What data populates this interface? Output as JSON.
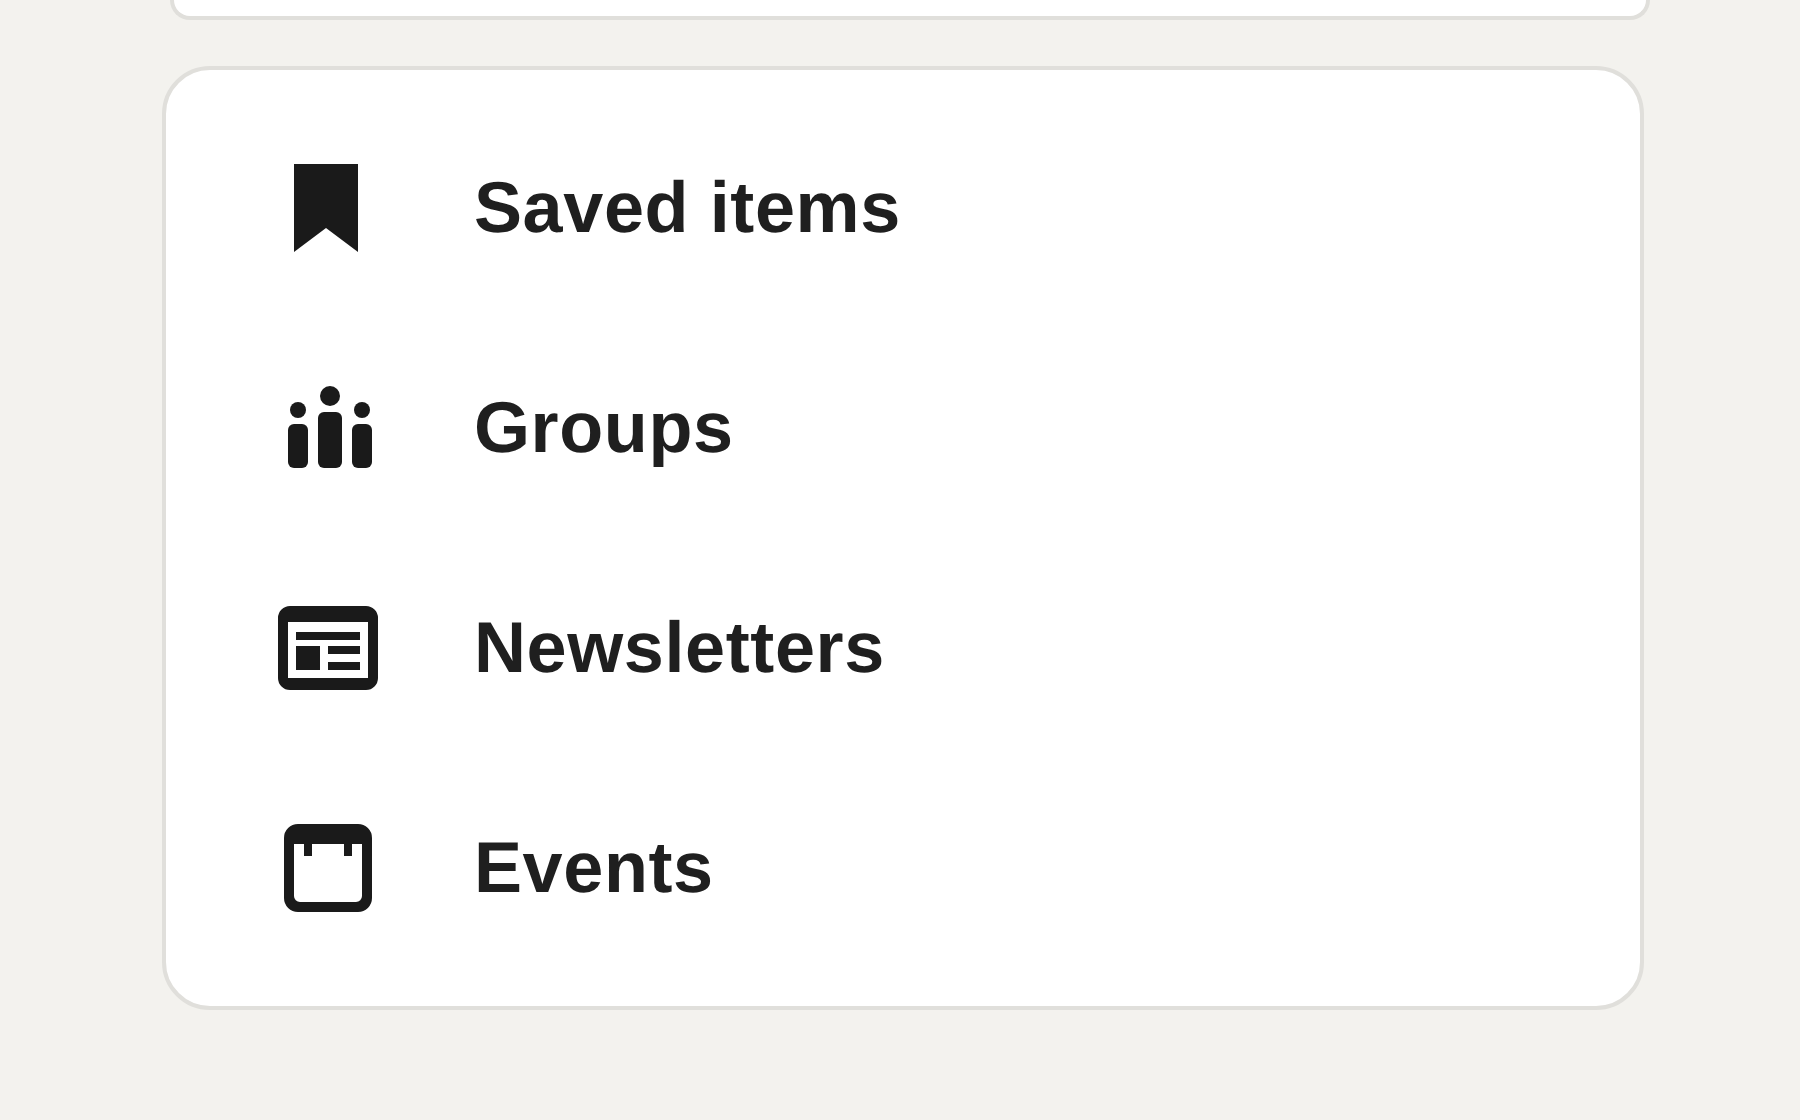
{
  "menu": {
    "items": [
      {
        "kind": "saved",
        "label": "Saved items"
      },
      {
        "kind": "groups",
        "label": "Groups"
      },
      {
        "kind": "newsletters",
        "label": "Newsletters"
      },
      {
        "kind": "events",
        "label": "Events"
      }
    ]
  }
}
